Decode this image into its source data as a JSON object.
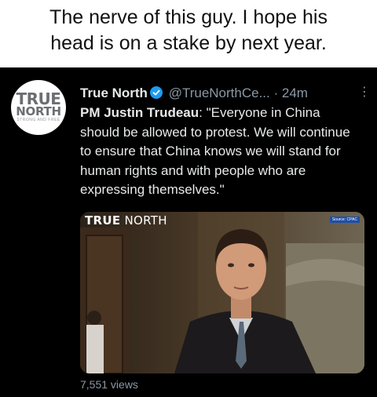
{
  "caption": {
    "line1": "The nerve of this guy. I hope his",
    "line2": "head is on a stake by next year."
  },
  "tweet": {
    "avatar": {
      "line1": "TRUE",
      "line2": "NORTH",
      "tagline": "STRONG AND FREE"
    },
    "author_name": "True North",
    "handle": "@TrueNorthCe...",
    "separator": "·",
    "time": "24m",
    "text_prefix": "PM Justin Trudeau",
    "text_rest": ": \"Everyone in China should be allowed to protest. We will continue to ensure that China knows we will stand for human rights and with people who are expressing themselves.\"",
    "media": {
      "brand_bold": "TRUE",
      "brand_rest": " NORTH",
      "source_badge": "Source: CPAC"
    },
    "views": "7,551 views"
  },
  "colors": {
    "background": "#000000",
    "text": "#e7e9ea",
    "muted": "#8b98a5",
    "verified": "#1d9bf0"
  },
  "icons": [
    "verified-badge-icon",
    "more-options-icon"
  ]
}
